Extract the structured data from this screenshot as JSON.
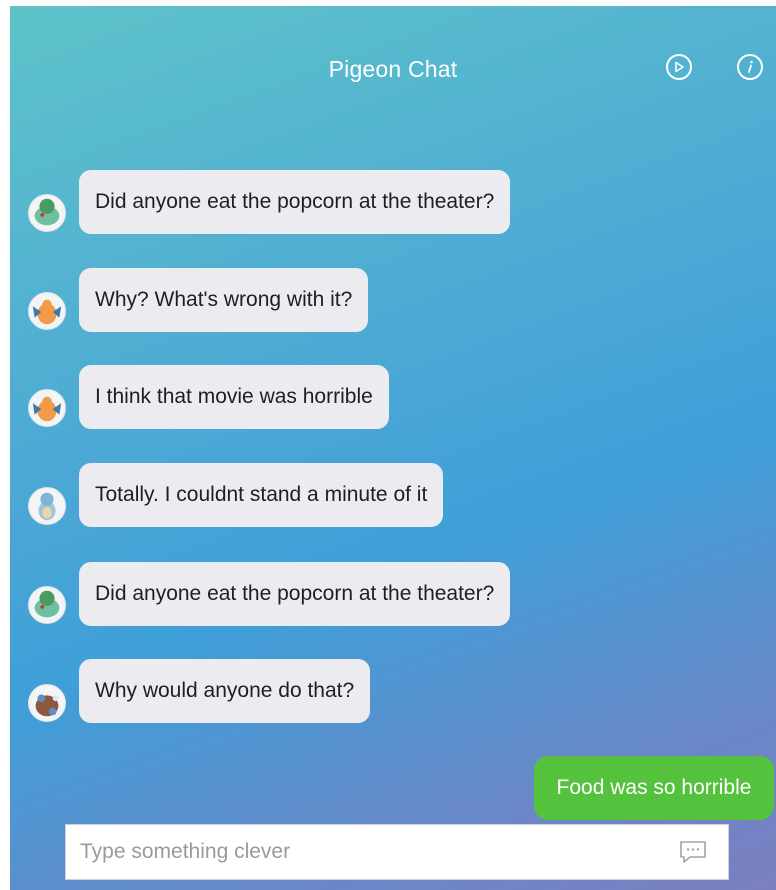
{
  "header": {
    "title": "Pigeon Chat",
    "icons": [
      "play-icon",
      "info-icon"
    ]
  },
  "messages": [
    {
      "avatar": "bulbasaur-avatar",
      "text": "Did anyone eat the popcorn at the theater?"
    },
    {
      "avatar": "charizard-avatar",
      "text": "Why? What's wrong with it?"
    },
    {
      "avatar": "charizard-avatar",
      "text": "I think that movie was horrible"
    },
    {
      "avatar": "squirtle-avatar",
      "text": "Totally. I couldnt stand a minute of it"
    },
    {
      "avatar": "bulbasaur-avatar",
      "text": "Did anyone eat the popcorn at the theater?"
    },
    {
      "avatar": "blastoise-avatar",
      "text": "Why would anyone do that?"
    }
  ],
  "outgoing": {
    "text": "Food was so horrible"
  },
  "composer": {
    "placeholder": "Type something clever",
    "value": ""
  },
  "colors": {
    "outgoing_bubble": "#55c23d",
    "incoming_bubble": "#ececf0",
    "header_text": "#ffffff"
  }
}
